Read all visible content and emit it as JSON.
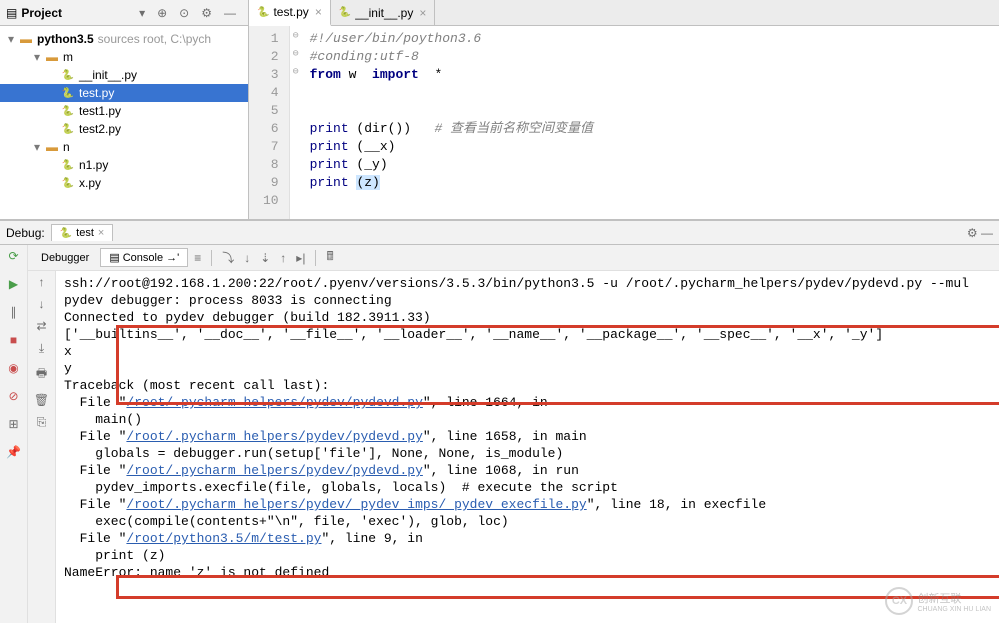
{
  "project": {
    "header_title": "Project",
    "root": {
      "label": "python3.5",
      "note": "sources root, C:\\pych"
    },
    "tree": [
      {
        "indent": 1,
        "arrow": "▾",
        "type": "folder",
        "label": "m"
      },
      {
        "indent": 2,
        "arrow": "",
        "type": "py",
        "label": "__init__.py",
        "selected": false
      },
      {
        "indent": 2,
        "arrow": "",
        "type": "py",
        "label": "test.py",
        "selected": true
      },
      {
        "indent": 2,
        "arrow": "",
        "type": "py",
        "label": "test1.py"
      },
      {
        "indent": 2,
        "arrow": "",
        "type": "py",
        "label": "test2.py"
      },
      {
        "indent": 1,
        "arrow": "▾",
        "type": "folder",
        "label": "n"
      },
      {
        "indent": 2,
        "arrow": "",
        "type": "py",
        "label": "n1.py"
      },
      {
        "indent": 2,
        "arrow": "",
        "type": "py",
        "label": "x.py"
      }
    ]
  },
  "editor": {
    "tabs": [
      {
        "label": "test.py",
        "active": true
      },
      {
        "label": "__init__.py",
        "active": false
      }
    ],
    "code_lines": [
      {
        "n": 1,
        "type": "comment",
        "text": "#!/user/bin/poython3.6"
      },
      {
        "n": 2,
        "type": "comment",
        "text": "#conding:utf-8"
      },
      {
        "n": 3,
        "type": "import",
        "text": "from w  import  *"
      },
      {
        "n": 4,
        "type": "blank",
        "text": ""
      },
      {
        "n": 5,
        "type": "blank",
        "text": ""
      },
      {
        "n": 6,
        "type": "print",
        "call": "print",
        "arg": "dir()",
        "comment": "# 查看当前名称空间变量值"
      },
      {
        "n": 7,
        "type": "print",
        "call": "print",
        "arg": "__x",
        "comment": ""
      },
      {
        "n": 8,
        "type": "print",
        "call": "print",
        "arg": "_y",
        "comment": ""
      },
      {
        "n": 9,
        "type": "print",
        "call": "print",
        "arg": "z",
        "highlight": true
      },
      {
        "n": 10,
        "type": "blank",
        "text": ""
      }
    ]
  },
  "debug": {
    "title": "Debug:",
    "tab_label": "test",
    "subtabs": {
      "debugger": "Debugger",
      "console": "Console"
    },
    "console_lines": [
      {
        "cls": "",
        "text": "ssh://root@192.168.1.200:22/root/.pyenv/versions/3.5.3/bin/python3.5 -u /root/.pycharm_helpers/pydev/pydevd.py --mul"
      },
      {
        "cls": "",
        "text": "pydev debugger: process 8033 is connecting"
      },
      {
        "cls": "",
        "text": ""
      },
      {
        "cls": "",
        "text": "Connected to pydev debugger (build 182.3911.33)"
      },
      {
        "cls": "",
        "text": "['__builtins__', '__doc__', '__file__', '__loader__', '__name__', '__package__', '__spec__', '__x', '_y']"
      },
      {
        "cls": "",
        "text": "x"
      },
      {
        "cls": "",
        "text": "y"
      },
      {
        "cls": "",
        "text": "Traceback (most recent call last):"
      },
      {
        "cls": "tb",
        "prefix": "  File \"",
        "link": "/root/.pycharm_helpers/pydev/pydevd.py",
        "suffix": "\", line 1664, in <module>"
      },
      {
        "cls": "",
        "text": "    main()"
      },
      {
        "cls": "tb",
        "prefix": "  File \"",
        "link": "/root/.pycharm_helpers/pydev/pydevd.py",
        "suffix": "\", line 1658, in main"
      },
      {
        "cls": "",
        "text": "    globals = debugger.run(setup['file'], None, None, is_module)"
      },
      {
        "cls": "tb",
        "prefix": "  File \"",
        "link": "/root/.pycharm_helpers/pydev/pydevd.py",
        "suffix": "\", line 1068, in run"
      },
      {
        "cls": "",
        "text": "    pydev_imports.execfile(file, globals, locals)  # execute the script"
      },
      {
        "cls": "tb",
        "prefix": "  File \"",
        "link": "/root/.pycharm_helpers/pydev/_pydev_imps/_pydev_execfile.py",
        "suffix": "\", line 18, in execfile"
      },
      {
        "cls": "",
        "text": "    exec(compile(contents+\"\\n\", file, 'exec'), glob, loc)"
      },
      {
        "cls": "tb",
        "prefix": "  File \"",
        "link": "/root/python3.5/m/test.py",
        "suffix": "\", line 9, in <module>"
      },
      {
        "cls": "",
        "text": "    print (z)"
      },
      {
        "cls": "",
        "text": "NameError: name 'z' is not defined"
      }
    ]
  },
  "watermark": {
    "brand": "创新互联",
    "sub": "CHUANG XIN HU LIAN"
  }
}
